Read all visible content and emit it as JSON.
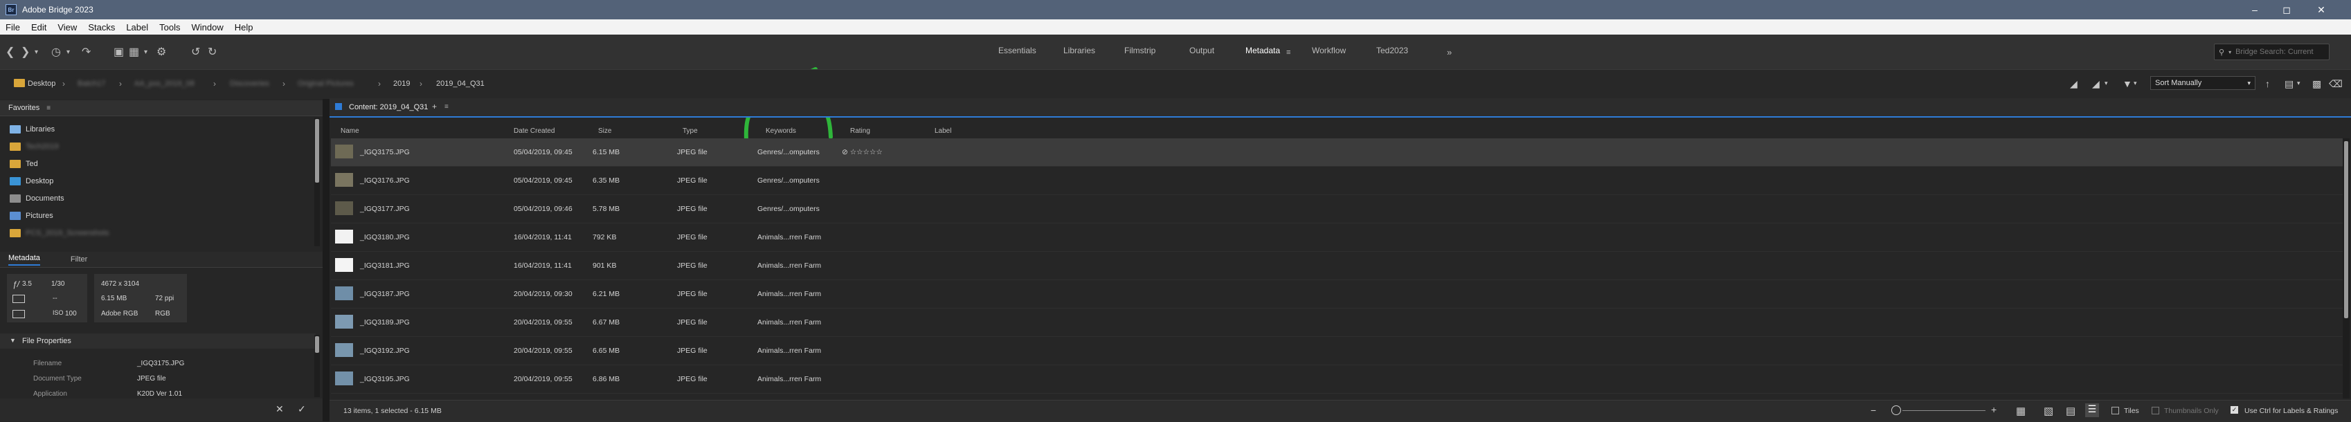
{
  "window": {
    "title": "Adobe Bridge 2023",
    "app_icon": "Br",
    "controls": [
      "minimize-icon",
      "maximize-icon",
      "close-icon"
    ]
  },
  "menu": [
    "File",
    "Edit",
    "View",
    "Stacks",
    "Label",
    "Tools",
    "Window",
    "Help"
  ],
  "workspaces": [
    "Essentials",
    "Libraries",
    "Filmstrip",
    "Output",
    "Metadata",
    "Workflow",
    "Ted2023"
  ],
  "active_workspace": "Metadata",
  "search": {
    "placeholder": "Bridge Search: Current"
  },
  "path": {
    "root": "Desktop",
    "blurred": [
      "Batch17",
      "AA_pxs_2019_08",
      "Discoveries",
      "Original Pictures"
    ],
    "folders": [
      "2019",
      "2019_04_Q31"
    ]
  },
  "sort": {
    "label": "Sort Manually"
  },
  "favorites": {
    "title": "Favorites",
    "items": [
      {
        "label": "Libraries",
        "color": "#7fb3e6",
        "blurred": false
      },
      {
        "label": "Tech2019",
        "color": "#d9a63a",
        "blurred": true
      },
      {
        "label": "Ted",
        "color": "#d9a63a",
        "blurred": false
      },
      {
        "label": "Desktop",
        "color": "#3a94d6",
        "blurred": false
      },
      {
        "label": "Documents",
        "color": "#8d8d8d",
        "blurred": false
      },
      {
        "label": "Pictures",
        "color": "#5b8ed0",
        "blurred": false
      },
      {
        "label": "PCS_2019_Screenshots",
        "color": "#d9a63a",
        "blurred": true
      }
    ]
  },
  "metadata_panel": {
    "tabs": [
      "Metadata",
      "Filter"
    ],
    "camera": {
      "fstop": "3.5",
      "shutter": "1/30",
      "dash1": "--",
      "iso_label": "ISO",
      "iso": "100"
    },
    "image": {
      "dimensions": "4672 x 3104",
      "size": "6.15 MB",
      "resolution": "72 ppi",
      "profile": "Adobe RGB",
      "mode": "RGB"
    },
    "section": "File Properties",
    "properties": [
      {
        "label": "Filename",
        "value": "_IGQ3175.JPG"
      },
      {
        "label": "Document Type",
        "value": "JPEG file"
      },
      {
        "label": "Application",
        "value": "K20D Ver 1.01"
      }
    ]
  },
  "content": {
    "tab_label": "Content: 2019_04_Q31",
    "columns": [
      "Name",
      "Date Created",
      "Size",
      "Type",
      "Keywords",
      "Rating",
      "Label"
    ],
    "rows": [
      {
        "name": "_IGQ3175.JPG",
        "date": "05/04/2019, 09:45",
        "size": "6.15 MB",
        "type": "JPEG file",
        "keywords": "Genres/...omputers",
        "rating": "⊘ ☆☆☆☆☆",
        "thumb": "#6e6a55",
        "selected": true
      },
      {
        "name": "_IGQ3176.JPG",
        "date": "05/04/2019, 09:45",
        "size": "6.35 MB",
        "type": "JPEG file",
        "keywords": "Genres/...omputers",
        "rating": "",
        "thumb": "#7a7560",
        "selected": false
      },
      {
        "name": "_IGQ3177.JPG",
        "date": "05/04/2019, 09:46",
        "size": "5.78 MB",
        "type": "JPEG file",
        "keywords": "Genres/...omputers",
        "rating": "",
        "thumb": "#5d5a4a",
        "selected": false
      },
      {
        "name": "_IGQ3180.JPG",
        "date": "16/04/2019, 11:41",
        "size": "792 KB",
        "type": "JPEG file",
        "keywords": "Animals...rren Farm",
        "rating": "",
        "thumb": "#f2f2f2",
        "selected": false
      },
      {
        "name": "_IGQ3181.JPG",
        "date": "16/04/2019, 11:41",
        "size": "901 KB",
        "type": "JPEG file",
        "keywords": "Animals...rren Farm",
        "rating": "",
        "thumb": "#f4f4f4",
        "selected": false
      },
      {
        "name": "_IGQ3187.JPG",
        "date": "20/04/2019, 09:30",
        "size": "6.21 MB",
        "type": "JPEG file",
        "keywords": "Animals...rren Farm",
        "rating": "",
        "thumb": "#6f8ea8",
        "selected": false
      },
      {
        "name": "_IGQ3189.JPG",
        "date": "20/04/2019, 09:55",
        "size": "6.67 MB",
        "type": "JPEG file",
        "keywords": "Animals...rren Farm",
        "rating": "",
        "thumb": "#7d9ab2",
        "selected": false
      },
      {
        "name": "_IGQ3192.JPG",
        "date": "20/04/2019, 09:55",
        "size": "6.65 MB",
        "type": "JPEG file",
        "keywords": "Animals...rren Farm",
        "rating": "",
        "thumb": "#7896ad",
        "selected": false
      },
      {
        "name": "_IGQ3195.JPG",
        "date": "20/04/2019, 09:55",
        "size": "6.86 MB",
        "type": "JPEG file",
        "keywords": "Animals...rren Farm",
        "rating": "",
        "thumb": "#7391a9",
        "selected": false
      }
    ]
  },
  "status": {
    "text": "13 items, 1 selected - 6.15 MB",
    "tiles_label": "Tiles",
    "thumbs_only_label": "Thumbnails Only",
    "ctrl_label": "Use Ctrl for Labels & Ratings"
  },
  "annotation_color": "#2fb53a"
}
